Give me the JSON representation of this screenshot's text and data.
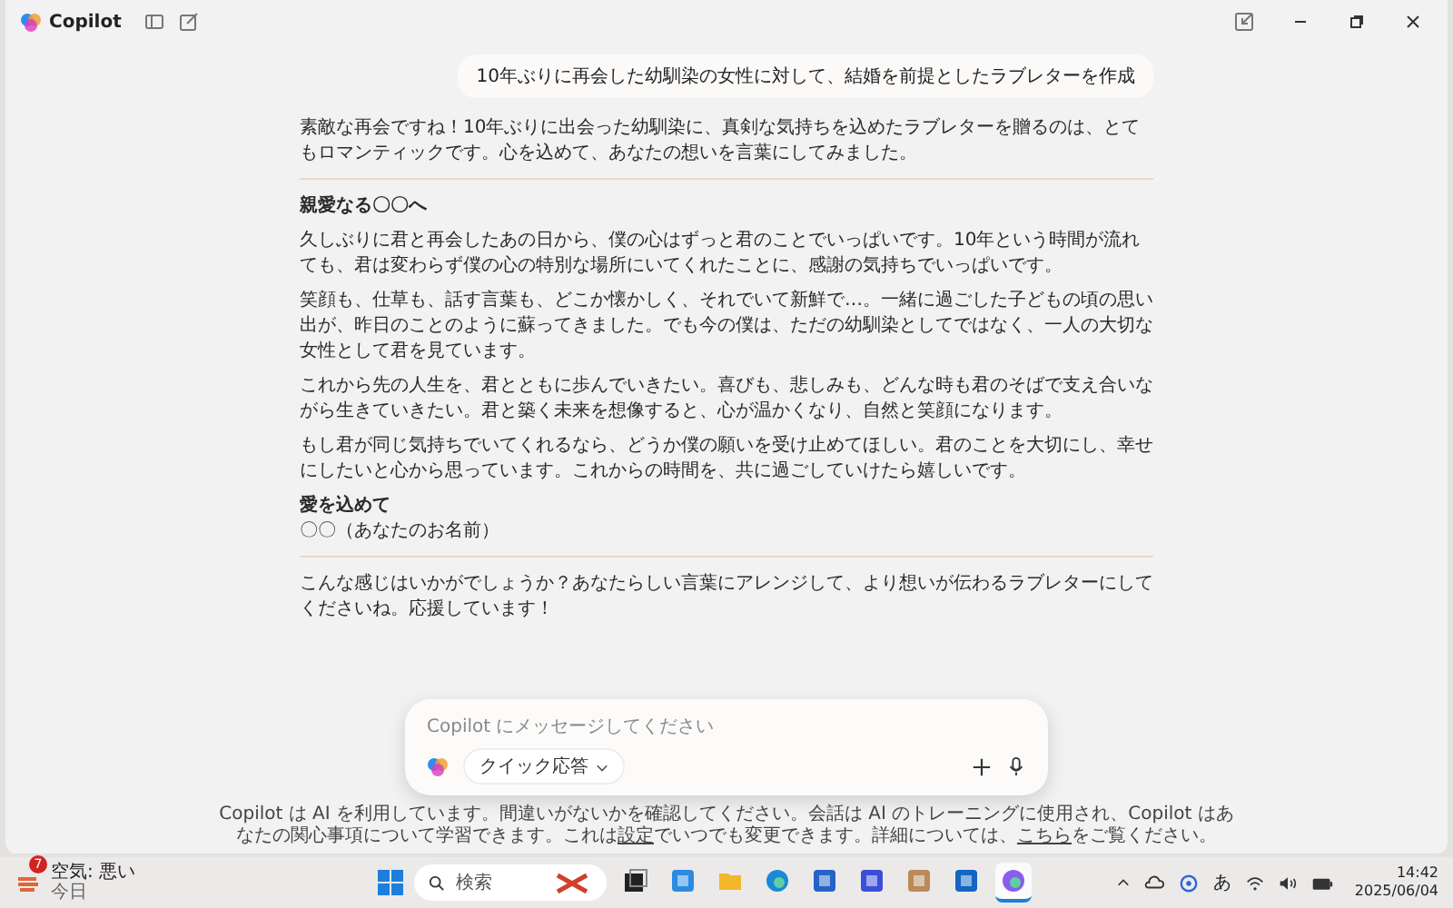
{
  "window": {
    "app_name": "Copilot"
  },
  "user_message": "10年ぶりに再会した幼馴染の女性に対して、結婚を前提としたラブレターを作成",
  "response": {
    "intro": "素敵な再会ですね！10年ぶりに出会った幼馴染に、真剣な気持ちを込めたラブレターを贈るのは、とてもロマンティックです。心を込めて、あなたの想いを言葉にしてみました。",
    "letter_heading": "親愛なる〇〇へ",
    "paragraphs": [
      "久しぶりに君と再会したあの日から、僕の心はずっと君のことでいっぱいです。10年という時間が流れても、君は変わらず僕の心の特別な場所にいてくれたことに、感謝の気持ちでいっぱいです。",
      "笑顔も、仕草も、話す言葉も、どこか懐かしく、それでいて新鮮で…。一緒に過ごした子どもの頃の思い出が、昨日のことのように蘇ってきました。でも今の僕は、ただの幼馴染としてではなく、一人の大切な女性として君を見ています。",
      "これから先の人生を、君とともに歩んでいきたい。喜びも、悲しみも、どんな時も君のそばで支え合いながら生きていきたい。君と築く未来を想像すると、心が温かくなり、自然と笑顔になります。",
      "もし君が同じ気持ちでいてくれるなら、どうか僕の願いを受け止めてほしい。君のことを大切にし、幸せにしたいと心から思っています。これからの時間を、共に過ごしていけたら嬉しいです。"
    ],
    "closing": "愛を込めて",
    "signature": "〇〇（あなたのお名前）",
    "outro": "こんな感じはいかがでしょうか？あなたらしい言葉にアレンジして、より想いが伝わるラブレターにしてくださいね。応援しています！"
  },
  "composer": {
    "placeholder": "Copilot にメッセージしてください",
    "mode": "クイック応答"
  },
  "disclaimer": {
    "before": "Copilot は AI を利用しています。間違いがないかを確認してください。会話は AI のトレーニングに使用され、Copilot はあなたの関心事項について学習できます。これは",
    "link_1": "設定",
    "middle": "でいつでも変更できます。詳細については、",
    "link_2": "こちら",
    "after": "をご覧ください。"
  },
  "taskbar": {
    "weather_badge": "7",
    "weather_title": "空気: 悪い",
    "weather_subtitle": "今日",
    "search_placeholder": "検索",
    "apps": [
      {
        "kind": "task-view",
        "selected": false
      },
      {
        "kind": "store-plus",
        "selected": false
      },
      {
        "kind": "folder",
        "selected": false
      },
      {
        "kind": "edge",
        "selected": false
      },
      {
        "kind": "store",
        "selected": false
      },
      {
        "kind": "editor",
        "selected": false
      },
      {
        "kind": "box",
        "selected": false
      },
      {
        "kind": "outlook",
        "selected": false
      },
      {
        "kind": "copilot",
        "selected": true
      }
    ],
    "ime": "あ",
    "time": "14:42",
    "date": "2025/06/04"
  }
}
